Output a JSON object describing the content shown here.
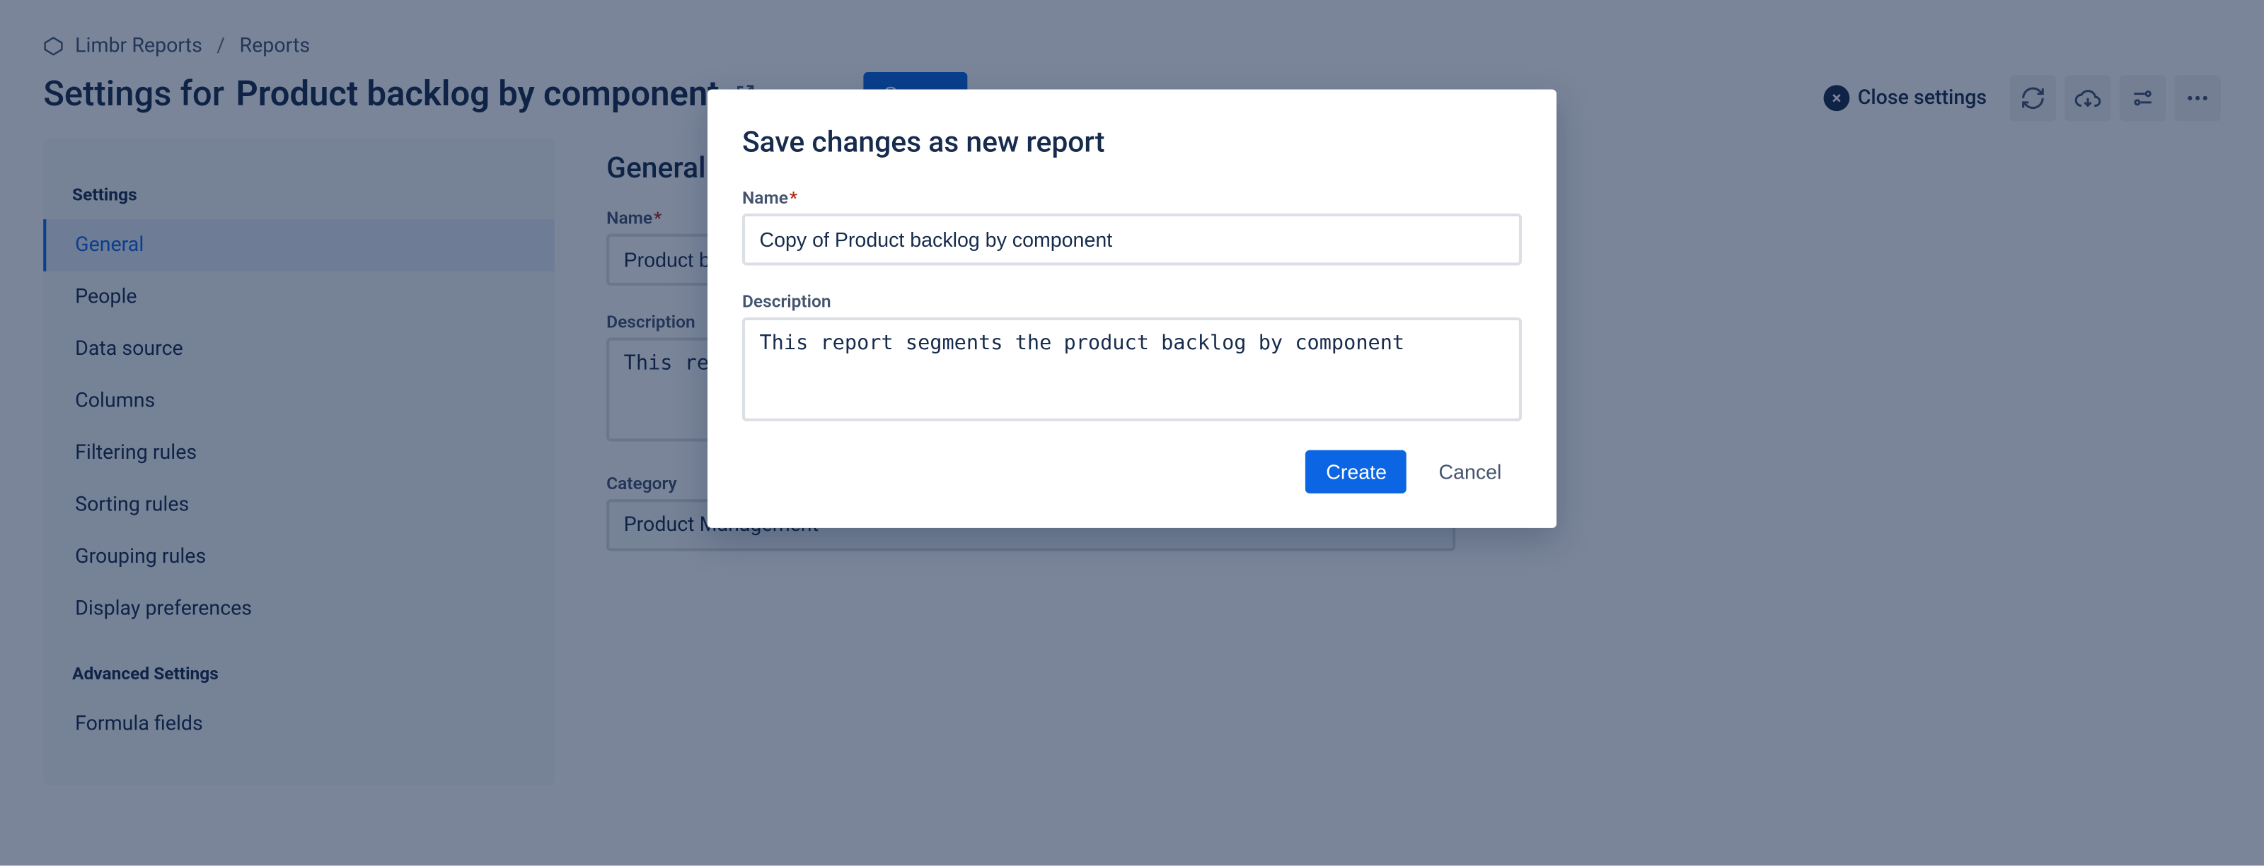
{
  "breadcrumbs": {
    "app": "Limbr Reports",
    "parent": "Reports"
  },
  "header": {
    "title_prefix": "Settings for",
    "title_name": "Product backlog by component",
    "save_button": "Save...",
    "close_settings": "Close settings"
  },
  "sidebar": {
    "section1": "Settings",
    "items": [
      {
        "label": "General"
      },
      {
        "label": "People"
      },
      {
        "label": "Data source"
      },
      {
        "label": "Columns"
      },
      {
        "label": "Filtering rules"
      },
      {
        "label": "Sorting rules"
      },
      {
        "label": "Grouping rules"
      },
      {
        "label": "Display preferences"
      }
    ],
    "section2": "Advanced Settings",
    "advanced": [
      {
        "label": "Formula fields"
      }
    ]
  },
  "main": {
    "section_title": "General",
    "name_label": "Name",
    "name_value": "Product backlog by component",
    "description_label": "Description",
    "description_value": "This report segments the product backlog by component",
    "category_label": "Category",
    "category_value": "Product Management"
  },
  "modal": {
    "title": "Save changes as new report",
    "name_label": "Name",
    "name_value": "Copy of Product backlog by component",
    "description_label": "Description",
    "description_value": "This report segments the product backlog by component",
    "create": "Create",
    "cancel": "Cancel"
  }
}
